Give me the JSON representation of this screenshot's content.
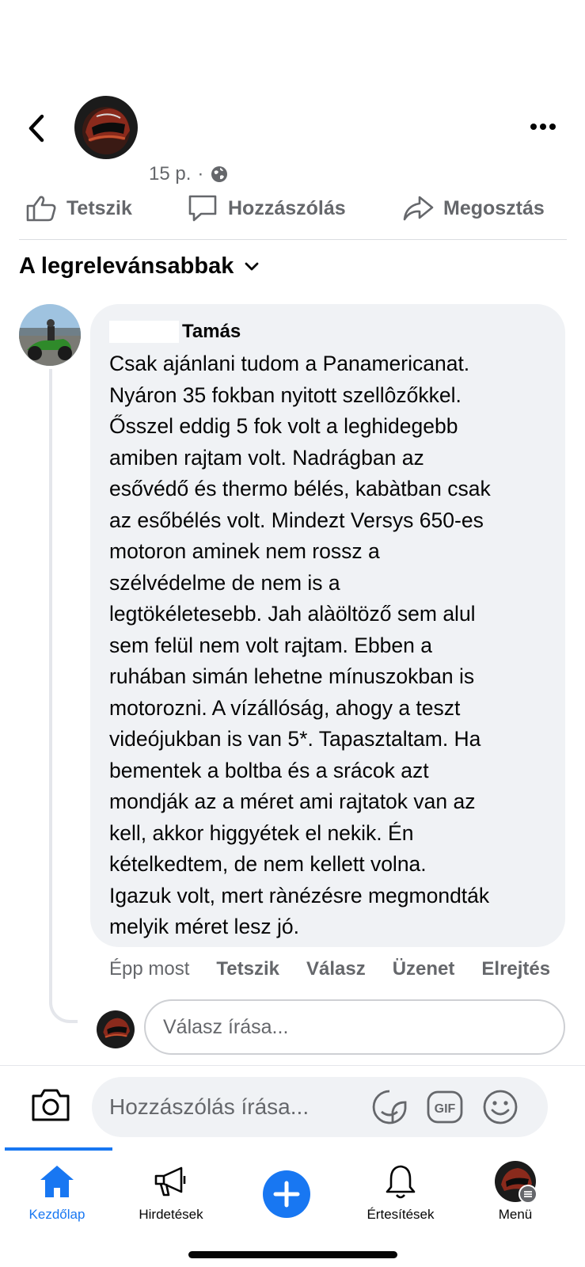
{
  "post": {
    "time": "15 p.",
    "dot": "·",
    "actions": {
      "like": "Tetszik",
      "comment": "Hozzászólás",
      "share": "Megosztás"
    }
  },
  "sort": {
    "label": "A legrelevánsabbak"
  },
  "comment": {
    "author": "Tamás",
    "text": "Csak ajánlani tudom a Panamericanat.\nNyáron 35 fokban nyitott szellôzőkkel.\nŐsszel eddig 5 fok volt a leghidegebb\namiben rajtam volt. Nadrágban az\nesővédő és thermo bélés, kabàtban csak\naz esőbélés volt. Mindezt Versys 650-es\nmotoron aminek nem rossz a\nszélvédelme de nem is a\nlegtökéletesebb. Jah alàöltöző sem alul\nsem felül nem volt rajtam. Ebben a\nruhában simán lehetne mínuszokban is\nmotorozni. A vízállóság, ahogy a teszt\nvideójukban is van 5*. Tapasztaltam.  Ha\nbementek a boltba és a srácok azt\nmondják az a méret ami rajtatok van az\nkell, akkor higgyétek el nekik. Én\nkételkedtem, de nem kellett volna.\nIgazuk volt, mert rànézésre megmondták\nmelyik méret lesz jó.",
    "time": "Épp most",
    "like": "Tetszik",
    "reply": "Válasz",
    "message": "Üzenet",
    "hide": "Elrejtés"
  },
  "reply_box": {
    "placeholder": "Válasz írása..."
  },
  "compose": {
    "placeholder": "Hozzászólás írása...",
    "gif": "GIF"
  },
  "nav": {
    "home": "Kezdőlap",
    "ads": "Hirdetések",
    "notifications": "Értesítések",
    "menu": "Menü"
  },
  "colors": {
    "accent": "#1877f2",
    "secondary_text": "#65676b",
    "bubble": "#f0f2f5"
  }
}
